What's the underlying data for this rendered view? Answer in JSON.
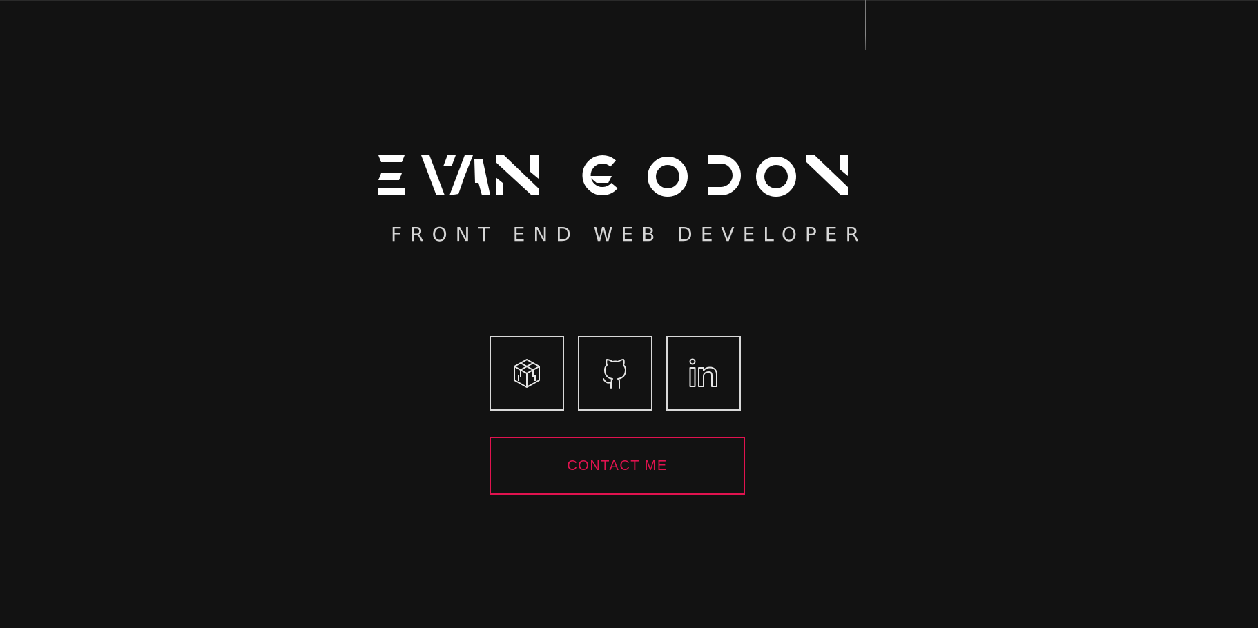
{
  "hero": {
    "name": "EVAN GODON",
    "subtitle": "FRONT END WEB DEVELOPER"
  },
  "social": [
    {
      "label": "CodeSandbox",
      "icon": "codesandbox-icon"
    },
    {
      "label": "GitHub",
      "icon": "github-icon"
    },
    {
      "label": "LinkedIn",
      "icon": "linkedin-icon"
    }
  ],
  "contact": {
    "label": "CONTACT ME"
  },
  "colors": {
    "background": "#121212",
    "text": "#ffffff",
    "subtitle": "#d6d6d6",
    "accent": "#e0134f",
    "icon_border": "#d9d9d9"
  }
}
